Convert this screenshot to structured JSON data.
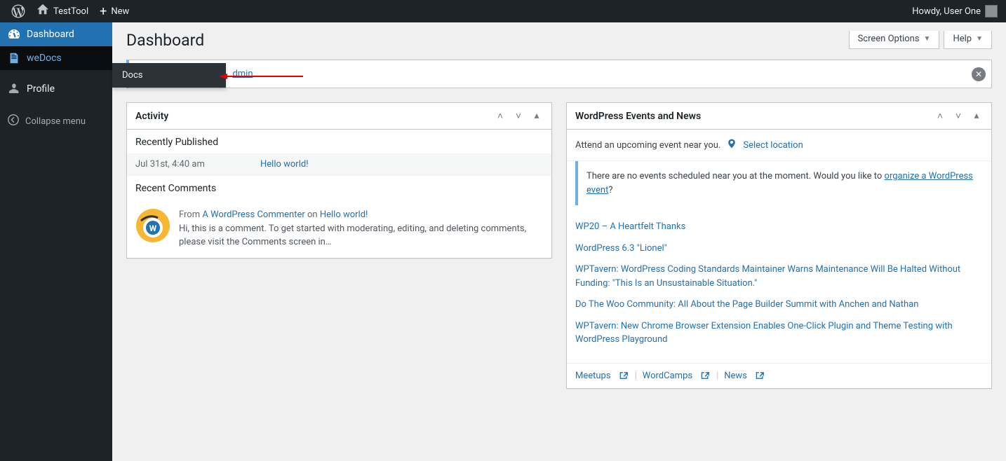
{
  "adminbar": {
    "site_name": "TestTool",
    "new_label": "New",
    "howdy": "Howdy, User One"
  },
  "sidebar": {
    "items": [
      {
        "label": "Dashboard",
        "icon": "dashboard"
      },
      {
        "label": "weDocs",
        "icon": "wedocs"
      },
      {
        "label": "Profile",
        "icon": "profile"
      }
    ],
    "collapse": "Collapse menu"
  },
  "flyout": {
    "items": [
      {
        "label": "Docs"
      }
    ]
  },
  "page": {
    "title": "Dashboard",
    "screen_options": "Screen Options",
    "help": "Help",
    "notice_fragment": "dmin",
    "notice_dot": "."
  },
  "widgets": {
    "activity": {
      "title": "Activity",
      "recently_published": "Recently Published",
      "published": [
        {
          "date": "Jul 31st, 4:40 am",
          "title": "Hello world!"
        }
      ],
      "recent_comments": "Recent Comments",
      "comments": [
        {
          "from_label": "From",
          "author": "A WordPress Commenter",
          "on_label": "on",
          "post": "Hello world!",
          "excerpt": "Hi, this is a comment. To get started with moderating, editing, and deleting comments, please visit the Comments screen in…"
        }
      ]
    },
    "events": {
      "title": "WordPress Events and News",
      "attend_label": "Attend an upcoming event near you.",
      "select_location": "Select location",
      "no_events_pre": "There are no events scheduled near you at the moment. Would you like to ",
      "organize_link": "organize a WordPress event",
      "no_events_post": "?",
      "news": [
        "WP20 – A Heartfelt Thanks",
        "WordPress 6.3 \"Lionel\"",
        "WPTavern: WordPress Coding Standards Maintainer Warns Maintenance Will Be Halted Without Funding: \"This Is an Unsustainable Situation.\"",
        "Do The Woo Community: All About the Page Builder Summit with Anchen and Nathan",
        "WPTavern: New Chrome Browser Extension Enables One-Click Plugin and Theme Testing with WordPress Playground"
      ],
      "footer": [
        "Meetups",
        "WordCamps",
        "News"
      ]
    }
  }
}
